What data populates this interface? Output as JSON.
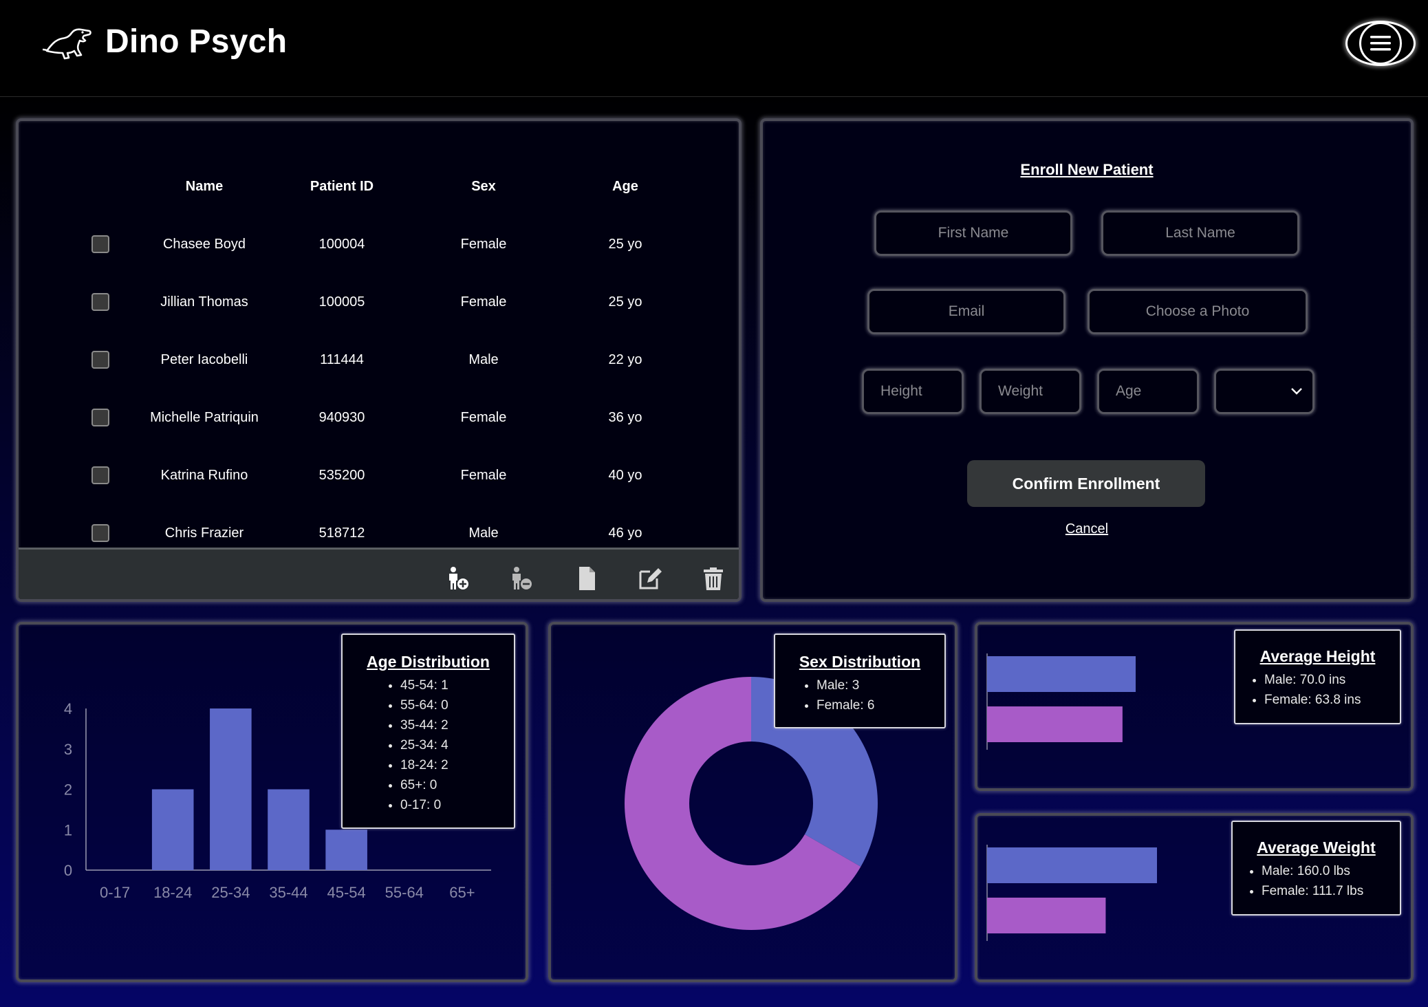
{
  "app": {
    "title": "Dino Psych"
  },
  "table": {
    "headers": [
      "Name",
      "Patient ID",
      "Sex",
      "Age"
    ],
    "rows": [
      {
        "name": "Chasee Boyd",
        "id": "100004",
        "sex": "Female",
        "age": "25 yo"
      },
      {
        "name": "Jillian Thomas",
        "id": "100005",
        "sex": "Female",
        "age": "25 yo"
      },
      {
        "name": "Peter Iacobelli",
        "id": "111444",
        "sex": "Male",
        "age": "22 yo"
      },
      {
        "name": "Michelle Patriquin",
        "id": "940930",
        "sex": "Female",
        "age": "36 yo"
      },
      {
        "name": "Katrina Rufino",
        "id": "535200",
        "sex": "Female",
        "age": "40 yo"
      },
      {
        "name": "Chris Frazier",
        "id": "518712",
        "sex": "Male",
        "age": "46 yo"
      }
    ],
    "toolbar_icons": [
      "add-patient-icon",
      "remove-patient-icon",
      "file-icon",
      "edit-icon",
      "trash-icon"
    ]
  },
  "enroll": {
    "title": "Enroll New Patient",
    "first_name_placeholder": "First Name",
    "last_name_placeholder": "Last Name",
    "email_placeholder": "Email",
    "photo_label": "Choose a Photo",
    "height_placeholder": "Height",
    "weight_placeholder": "Weight",
    "age_placeholder": "Age",
    "sex_select_value": "",
    "confirm_label": "Confirm Enrollment",
    "cancel_label": "Cancel"
  },
  "colors": {
    "male": "#5c68c8",
    "female": "#a85bc8",
    "bar": "#5c68c8"
  },
  "chart_data": [
    {
      "type": "bar",
      "title": "Age Distribution",
      "categories": [
        "0-17",
        "18-24",
        "25-34",
        "35-44",
        "45-54",
        "55-64",
        "65+"
      ],
      "values": [
        0,
        2,
        4,
        2,
        1,
        0,
        0
      ],
      "ylim": [
        0,
        4
      ],
      "yticks": [
        "0",
        "1",
        "2",
        "3",
        "4"
      ],
      "legend_items": [
        "45-54: 1",
        "55-64: 0",
        "35-44: 2",
        "25-34: 4",
        "18-24: 2",
        "65+: 0",
        "0-17: 0"
      ]
    },
    {
      "type": "pie",
      "title": "Sex Distribution",
      "labels": [
        "Male",
        "Female"
      ],
      "values": [
        3,
        6
      ],
      "legend_items": [
        "Male: 3",
        "Female: 6"
      ]
    },
    {
      "type": "bar",
      "title": "Average Height",
      "categories": [
        "Male",
        "Female"
      ],
      "values": [
        70.0,
        63.8
      ],
      "legend_items": [
        "Male: 70.0 ins",
        "Female: 63.8 ins"
      ]
    },
    {
      "type": "bar",
      "title": "Average Weight",
      "categories": [
        "Male",
        "Female"
      ],
      "values": [
        160.0,
        111.7
      ],
      "legend_items": [
        "Male: 160.0 lbs",
        "Female: 111.7 lbs"
      ]
    }
  ]
}
